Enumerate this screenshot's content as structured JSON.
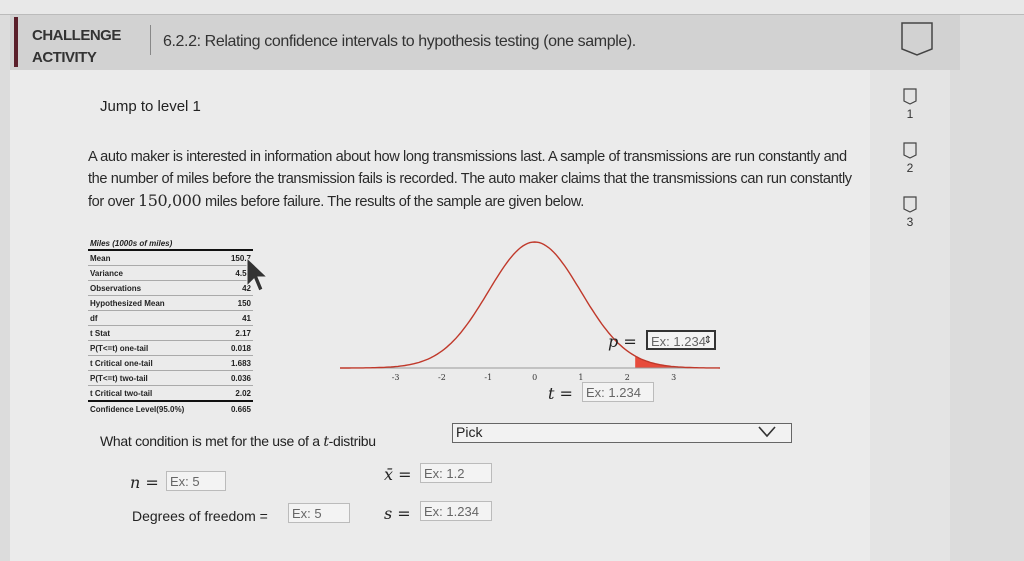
{
  "header": {
    "activity_label_line1": "CHALLENGE",
    "activity_label_line2": "ACTIVITY",
    "title": "6.2.2: Relating confidence intervals to hypothesis testing (one sample)."
  },
  "jump_to_level": "Jump to level 1",
  "problem": {
    "text_before_number": "A auto maker is interested in information about how long transmissions last. A sample of transmissions are run constantly and the number of miles before the transmission fails is recorded. The auto maker claims that the transmissions can run constantly for over ",
    "number": "150,000",
    "text_after_number": " miles before failure. The results of the sample are given below."
  },
  "levels": [
    {
      "label": "1"
    },
    {
      "label": "2"
    },
    {
      "label": "3"
    }
  ],
  "stats_table": {
    "header": "Miles (1000s of miles)",
    "rows": [
      {
        "label": "Mean",
        "value": "150.7"
      },
      {
        "label": "Variance",
        "value": "4.55"
      },
      {
        "label": "Observations",
        "value": "42"
      },
      {
        "label": "Hypothesized Mean",
        "value": "150"
      },
      {
        "label": "df",
        "value": "41"
      },
      {
        "label": "t Stat",
        "value": "2.17"
      },
      {
        "label": "P(T<=t) one-tail",
        "value": "0.018"
      },
      {
        "label": "t Critical one-tail",
        "value": "1.683"
      },
      {
        "label": "P(T<=t) two-tail",
        "value": "0.036"
      },
      {
        "label": "t Critical two-tail",
        "value": "2.02"
      },
      {
        "label": "Confidence Level(95.0%)",
        "value": "0.665"
      }
    ]
  },
  "chart_data": {
    "type": "area",
    "title": "",
    "description": "t-distribution density curve with shaded right tail",
    "x_ticks": [
      "-3",
      "-2",
      "-1",
      "0",
      "1",
      "2",
      "3"
    ],
    "xlim": [
      -4.2,
      4
    ],
    "shaded_region": {
      "from": 2.17,
      "to": 4
    },
    "curve_color": "#c0392b",
    "shade_color": "#e74c3c"
  },
  "inputs": {
    "p_label": "p =",
    "p_placeholder": "Ex: 1.234",
    "t_label": "t =",
    "t_placeholder": "Ex: 1.234",
    "n_label": "n =",
    "n_placeholder": "Ex: 5",
    "xbar_label": "x̄ =",
    "xbar_placeholder": "Ex: 1.2",
    "df_label": "Degrees of freedom =",
    "df_placeholder": "Ex: 5",
    "s_label": "s =",
    "s_placeholder": "Ex: 1.234"
  },
  "question": {
    "text_before": "What condition is met for the use of a ",
    "t_symbol": "t",
    "text_after": "-distribu",
    "select_value": "Pick"
  }
}
